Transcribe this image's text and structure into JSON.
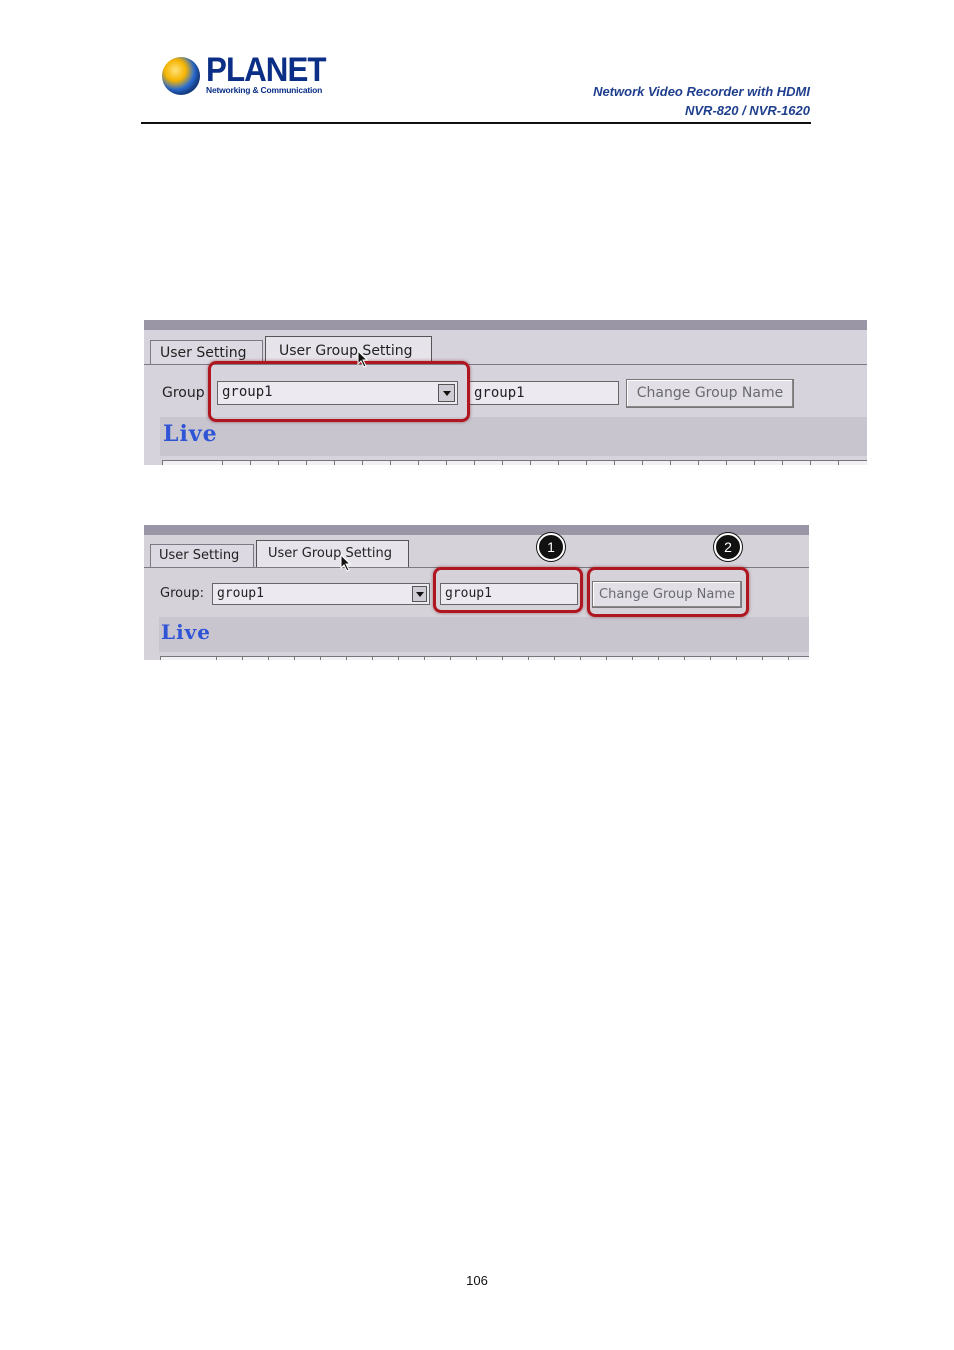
{
  "header": {
    "logo_text": "PLANET",
    "logo_subtext": "Networking & Communication",
    "doc_title": "Network Video Recorder with HDMI",
    "doc_models": "NVR-820 / NVR-1620"
  },
  "screenshot1": {
    "tabs": [
      "User Setting",
      "User Group Setting"
    ],
    "active_tab": "User Group Setting",
    "group_label": "Group",
    "group_select_value": "group1",
    "group_name_value": "group1",
    "change_button_label": "Change Group Name",
    "section_label": "Live"
  },
  "screenshot2": {
    "tabs": [
      "User Setting",
      "User Group Setting"
    ],
    "active_tab": "User Group Setting",
    "group_label": "Group:",
    "group_select_value": "group1",
    "group_name_value": "group1",
    "change_button_label": "Change Group Name",
    "section_label": "Live",
    "callouts": [
      "1",
      "2"
    ]
  },
  "highlight_color": "#b01620",
  "page_number": "106"
}
